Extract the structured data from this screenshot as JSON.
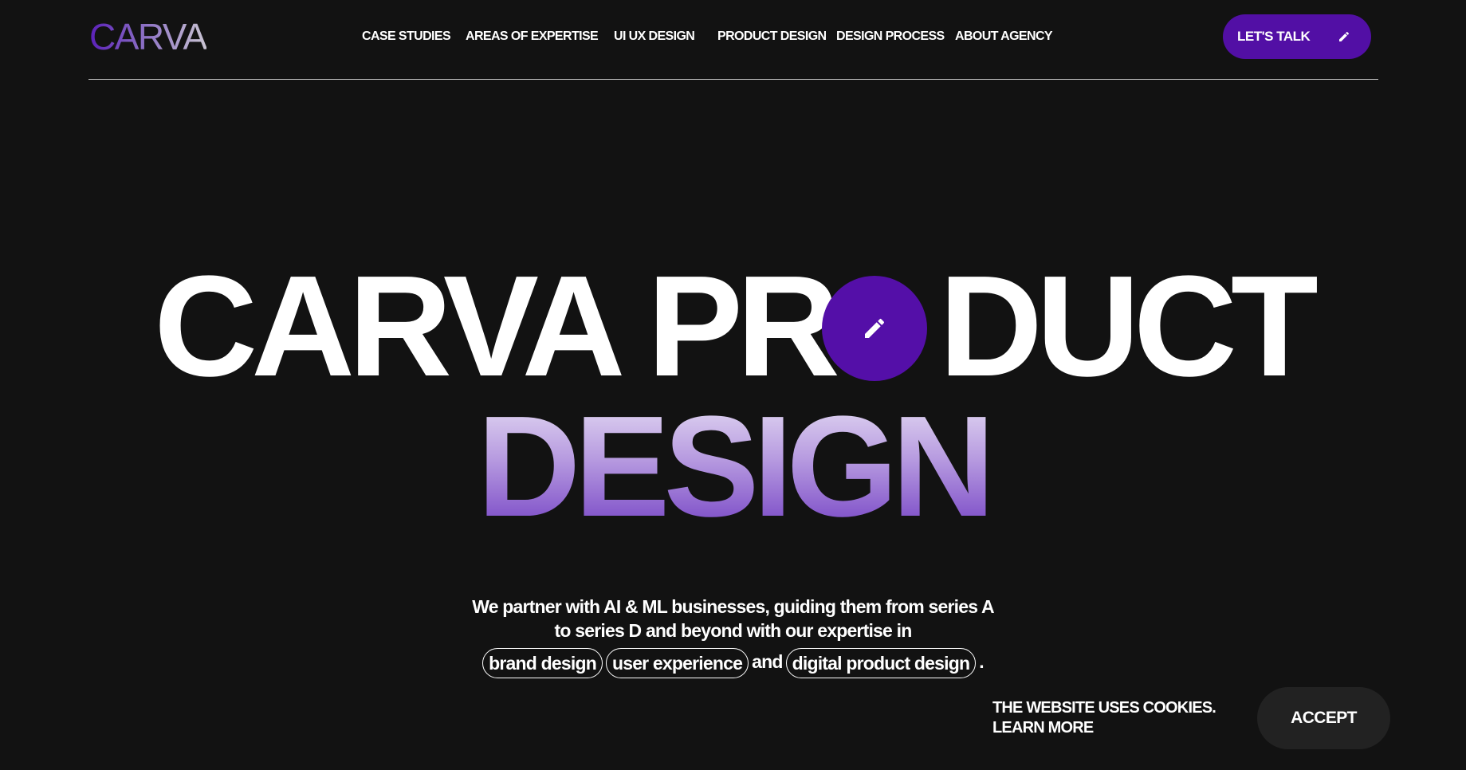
{
  "header": {
    "logo": "CARVA",
    "nav": [
      {
        "label": "CASE STUDIES"
      },
      {
        "label": "AREAS OF EXPERTISE"
      },
      {
        "label": "UI UX DESIGN"
      },
      {
        "label": "PRODUCT DESIGN"
      },
      {
        "label": "DESIGN PROCESS"
      },
      {
        "label": "ABOUT AGENCY"
      }
    ],
    "cta_label": "LET'S TALK",
    "cta_icon": "pencil-icon"
  },
  "hero": {
    "line1_part1": "CARVA PR",
    "line1_part2": "DUCT",
    "line2": "DESIGN",
    "circle_icon": "pencil-icon"
  },
  "description": {
    "line1": "We partner with AI & ML businesses, guiding them from series A",
    "line2": "to series D and beyond with our expertise in",
    "pill1": "brand design",
    "pill2": "user experience",
    "connector": "and",
    "pill3": "digital product design",
    "end": "."
  },
  "cookie": {
    "text": "THE WEBSITE USES COOKIES.",
    "learn_more": "LEARN MORE",
    "accept": "ACCEPT"
  },
  "colors": {
    "background": "#121212",
    "accent": "#520fa5",
    "text": "#ffffff",
    "accept_bg": "#222222"
  }
}
